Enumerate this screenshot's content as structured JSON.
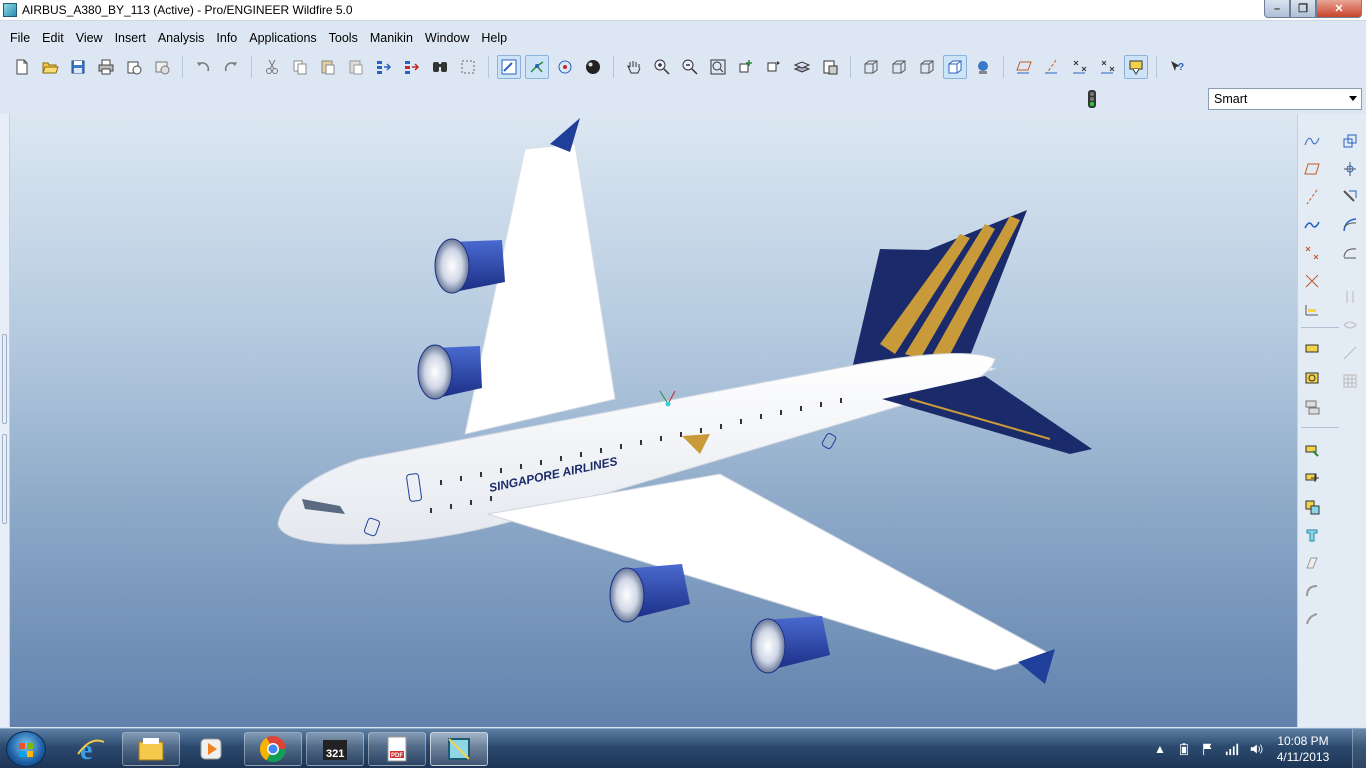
{
  "window": {
    "title": "AIRBUS_A380_BY_113 (Active) - Pro/ENGINEER Wildfire 5.0",
    "controls": {
      "minimize": "–",
      "maximize": "❐",
      "close": "✕"
    }
  },
  "menu": [
    "File",
    "Edit",
    "View",
    "Insert",
    "Analysis",
    "Info",
    "Applications",
    "Tools",
    "Manikin",
    "Window",
    "Help"
  ],
  "toolbar": {
    "icons": [
      "new-icon",
      "open-icon",
      "save-icon",
      "print-icon",
      "send-mail-icon",
      "send-attachment-icon",
      "undo-icon",
      "redo-icon",
      "cut-icon",
      "copy-icon",
      "paste-icon",
      "paste-special-icon",
      "regenerate-icon",
      "regen-manager-icon",
      "find-icon",
      "select-box-icon",
      "repaint-icon",
      "spin-center-icon",
      "orient-mode-icon",
      "appearance-icon",
      "pan-icon",
      "zoom-in-icon",
      "zoom-out-icon",
      "refit-icon",
      "reorient-icon",
      "saved-views-icon",
      "layers-icon",
      "wireframe-icon",
      "hidden-line-icon",
      "no-hidden-icon",
      "shading-icon",
      "realtime-render-icon",
      "datum-planes-icon",
      "datum-axes-icon",
      "datum-points-icon",
      "coord-sys-icon",
      "annotations-icon",
      "context-help-icon"
    ]
  },
  "filter": {
    "selected": "Smart"
  },
  "status": {
    "regen_light": "traffic-light-icon"
  },
  "model": {
    "name": "AIRBUS_A380_BY_113",
    "livery_text": "SINGAPORE AIRLINES",
    "colors": {
      "fuselage": "#ffffff",
      "engine": "#1f3f9a",
      "tail": "#1a2a6a",
      "gold": "#c99a3a"
    }
  },
  "right_toolbar": {
    "icons": [
      "sketch-icon",
      "datum-plane-icon",
      "datum-axis-icon",
      "datum-curve-icon",
      "datum-point-icon",
      "point-offset-icon",
      "coord-csys-icon",
      "extrude-icon",
      "revolve-icon",
      "sweep-icon",
      "blend-icon",
      "style-icon",
      "hole-icon",
      "shell-icon",
      "rib-icon",
      "draft-icon",
      "round-icon",
      "chamfer-icon",
      "pattern-icon",
      "mirror-icon",
      "merge-icon",
      "trim-icon",
      "offset-icon",
      "thicken-icon",
      "solidify-icon"
    ]
  },
  "taskbar": {
    "items": [
      "windows-explorer-icon",
      "ie-icon",
      "file-manager-icon",
      "media-player-icon",
      "chrome-icon",
      "media-player-classic-icon",
      "pdf-tool-icon",
      "proe-icon"
    ],
    "clock_time": "10:08 PM",
    "clock_date": "4/11/2013"
  }
}
